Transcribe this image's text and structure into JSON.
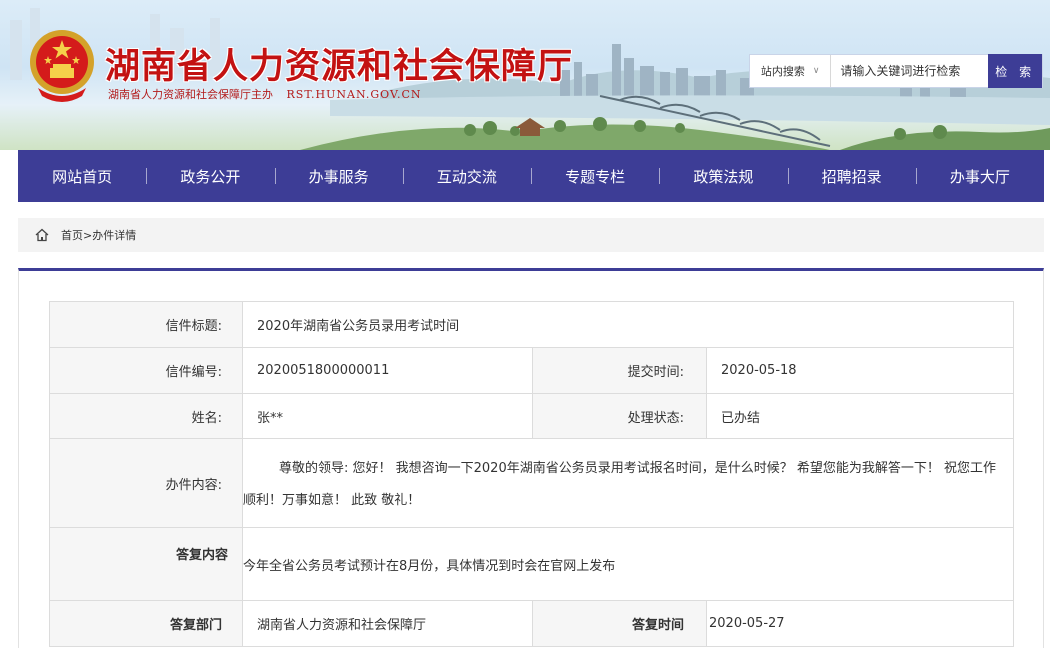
{
  "header": {
    "title": "湖南省人力资源和社会保障厅",
    "subtitle": "湖南省人力资源和社会保障厅主办",
    "site_url": "RST.HUNAN.GOV.CN"
  },
  "search": {
    "scope_label": "站内搜索",
    "placeholder": "请输入关键词进行检索",
    "button_label": "检 索"
  },
  "nav": {
    "items": [
      {
        "label": "网站首页"
      },
      {
        "label": "政务公开"
      },
      {
        "label": "办事服务"
      },
      {
        "label": "互动交流"
      },
      {
        "label": "专题专栏"
      },
      {
        "label": "政策法规"
      },
      {
        "label": "招聘招录"
      },
      {
        "label": "办事大厅"
      }
    ]
  },
  "breadcrumb": {
    "home": "首页",
    "separator": ">",
    "current": "办件详情"
  },
  "detail": {
    "title_label": "信件标题:",
    "title_value": "2020年湖南省公务员录用考试时间",
    "number_label": "信件编号:",
    "number_value": "2020051800000011",
    "submit_time_label": "提交时间:",
    "submit_time_value": "2020-05-18",
    "name_label": "姓名:",
    "name_value": "张**",
    "status_label": "处理状态:",
    "status_value": "已办结",
    "content_label": "办件内容:",
    "content_value": "尊敬的领导: 您好！ 我想咨询一下2020年湖南省公务员录用考试报名时间，是什么时候？ 希望您能为我解答一下！ 祝您工作顺利！万事如意！ 此致 敬礼！",
    "reply_label": "答复内容",
    "reply_value": "今年全省公务员考试预计在8月份，具体情况到时会在官网上发布",
    "reply_dept_label": "答复部门",
    "reply_dept_value": "湖南省人力资源和社会保障厅",
    "reply_time_label": "答复时间",
    "reply_time_value": "2020-05-27"
  },
  "colors": {
    "brand_blue": "#3d3d96",
    "title_red": "#c31212"
  }
}
